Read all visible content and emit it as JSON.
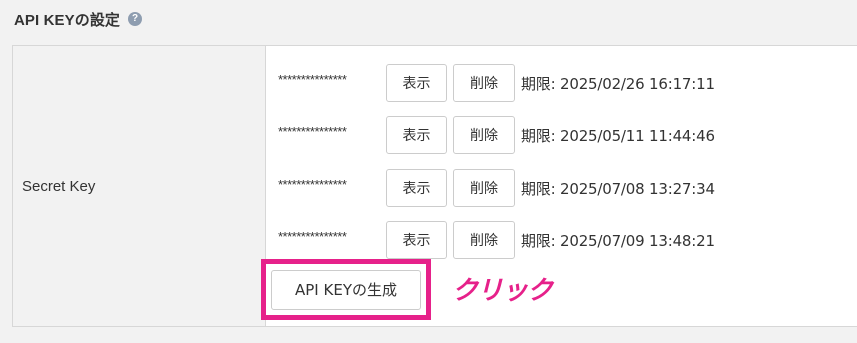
{
  "section": {
    "title": "API KEYの設定",
    "help_icon": "question-circle-icon",
    "help_glyph": "?"
  },
  "secret_key": {
    "label": "Secret Key",
    "keys": [
      {
        "masked": "***************",
        "show_label": "表示",
        "delete_label": "削除",
        "expiry": "期限: 2025/02/26 16:17:11"
      },
      {
        "masked": "***************",
        "show_label": "表示",
        "delete_label": "削除",
        "expiry": "期限: 2025/05/11 11:44:46"
      },
      {
        "masked": "***************",
        "show_label": "表示",
        "delete_label": "削除",
        "expiry": "期限: 2025/07/08 13:27:34"
      },
      {
        "masked": "***************",
        "show_label": "表示",
        "delete_label": "削除",
        "expiry": "期限: 2025/07/09 13:48:21"
      }
    ],
    "generate_label": "API KEYの生成"
  },
  "annotation": {
    "text": "クリック",
    "color": "#e6218a"
  }
}
